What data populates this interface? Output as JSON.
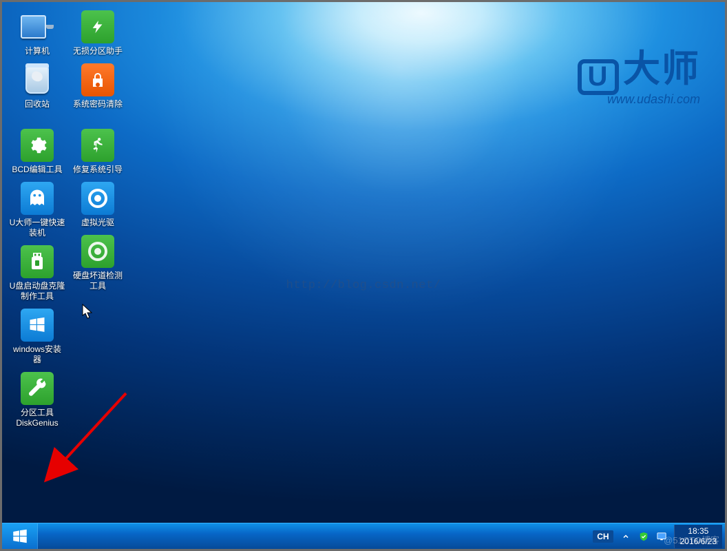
{
  "brand": {
    "logo_u": "U",
    "logo_text": "大师",
    "url": "www.udashi.com"
  },
  "watermark": "http://blog.csdn.net/",
  "blog_watermark": "@51CTO博客",
  "taskbar": {
    "lang": "CH",
    "time": "18:35",
    "date": "2016/6/23"
  },
  "col1": [
    {
      "name": "computer",
      "label": "计算机"
    },
    {
      "name": "recycle-bin",
      "label": "回收站"
    },
    {
      "name": "bcd-editor",
      "label": "BCD编辑工具"
    },
    {
      "name": "udashi-install",
      "label": "U大师一键快速装机"
    },
    {
      "name": "usb-boot-clone",
      "label": "U盘启动盘克隆制作工具"
    },
    {
      "name": "windows-install",
      "label": "windows安装器"
    },
    {
      "name": "diskgenius",
      "label": "分区工具DiskGenius"
    }
  ],
  "col2": [
    {
      "name": "lossless-part",
      "label": "无损分区助手"
    },
    {
      "name": "password-clear",
      "label": "系统密码清除"
    },
    {
      "name": "boot-repair",
      "label": "修复系统引导"
    },
    {
      "name": "virtual-drive",
      "label": "虚拟光驱"
    },
    {
      "name": "bad-sector",
      "label": "硬盘坏道检测工具"
    }
  ]
}
